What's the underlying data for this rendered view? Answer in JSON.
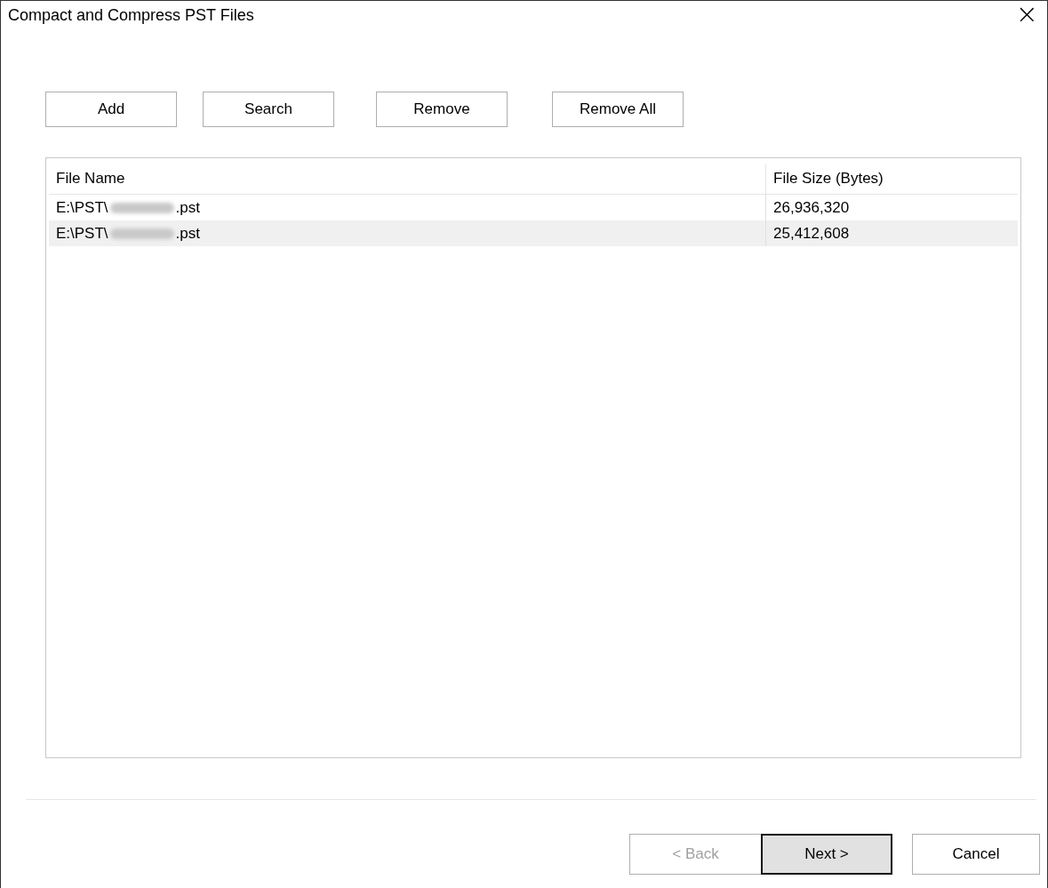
{
  "window": {
    "title": "Compact and Compress PST Files",
    "close": "×"
  },
  "toolbar": [
    {
      "label": "Add"
    },
    {
      "label": "Search"
    },
    {
      "label": "Remove"
    },
    {
      "label": "Remove All"
    }
  ],
  "table": {
    "columns": [
      "File Name",
      "File Size (Bytes)"
    ],
    "rows": [
      {
        "path": "E:\\PST\\",
        "redacted": true,
        "ext": " .pst",
        "size": "26,936,320",
        "selected": false
      },
      {
        "path": "E:\\PST\\",
        "redacted": true,
        "ext": ".pst",
        "size": "25,412,608",
        "selected": true
      }
    ]
  },
  "buttons": [
    {
      "label": "< Back",
      "disabled": true,
      "default": false
    },
    {
      "label": "Next >",
      "disabled": false,
      "default": true
    },
    {
      "label": "Cancel",
      "disabled": false,
      "default": false
    }
  ]
}
